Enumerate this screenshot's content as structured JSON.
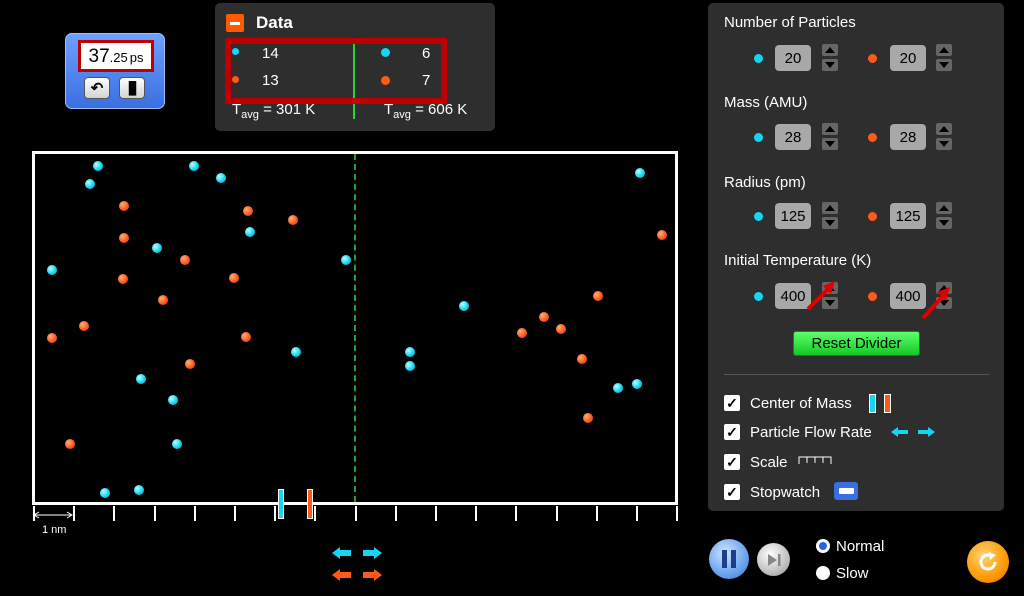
{
  "stopwatch": {
    "seconds": "37",
    "fraction": ".25",
    "unit": "ps",
    "reset_icon": "reset-icon",
    "pause_icon": "pause-icon"
  },
  "data_panel": {
    "title": "Data",
    "left": {
      "blue_count": "14",
      "red_count": "13",
      "tavg_prefix": "T",
      "tavg_sub": "avg",
      "tavg_value": " = 301 K"
    },
    "right": {
      "blue_count": "6",
      "red_count": "7",
      "tavg_prefix": "T",
      "tavg_sub": "avg",
      "tavg_value": " = 606 K"
    },
    "divider_color": "#2bd42b"
  },
  "colors": {
    "blue_particle": "#16d5f0",
    "red_particle": "#ff5a1a",
    "highlight": "#c00000",
    "panel_bg": "#2e2e2e",
    "reset_divider_green": "#14c825"
  },
  "scale": {
    "label": "1 nm"
  },
  "controls": {
    "number_of_particles": {
      "label": "Number of Particles",
      "blue": "20",
      "red": "20"
    },
    "mass": {
      "label": "Mass (AMU)",
      "blue": "28",
      "red": "28"
    },
    "radius": {
      "label": "Radius (pm)",
      "blue": "125",
      "red": "125"
    },
    "initial_temperature": {
      "label": "Initial Temperature (K)",
      "blue": "400",
      "red": "400"
    },
    "reset_divider": "Reset Divider",
    "checkboxes": [
      {
        "label": "Center of Mass",
        "checked": true
      },
      {
        "label": "Particle Flow Rate",
        "checked": true
      },
      {
        "label": "Scale",
        "checked": true
      },
      {
        "label": "Stopwatch",
        "checked": true
      }
    ]
  },
  "playback": {
    "speeds": [
      "Normal",
      "Slow"
    ],
    "selected": "Normal"
  }
}
